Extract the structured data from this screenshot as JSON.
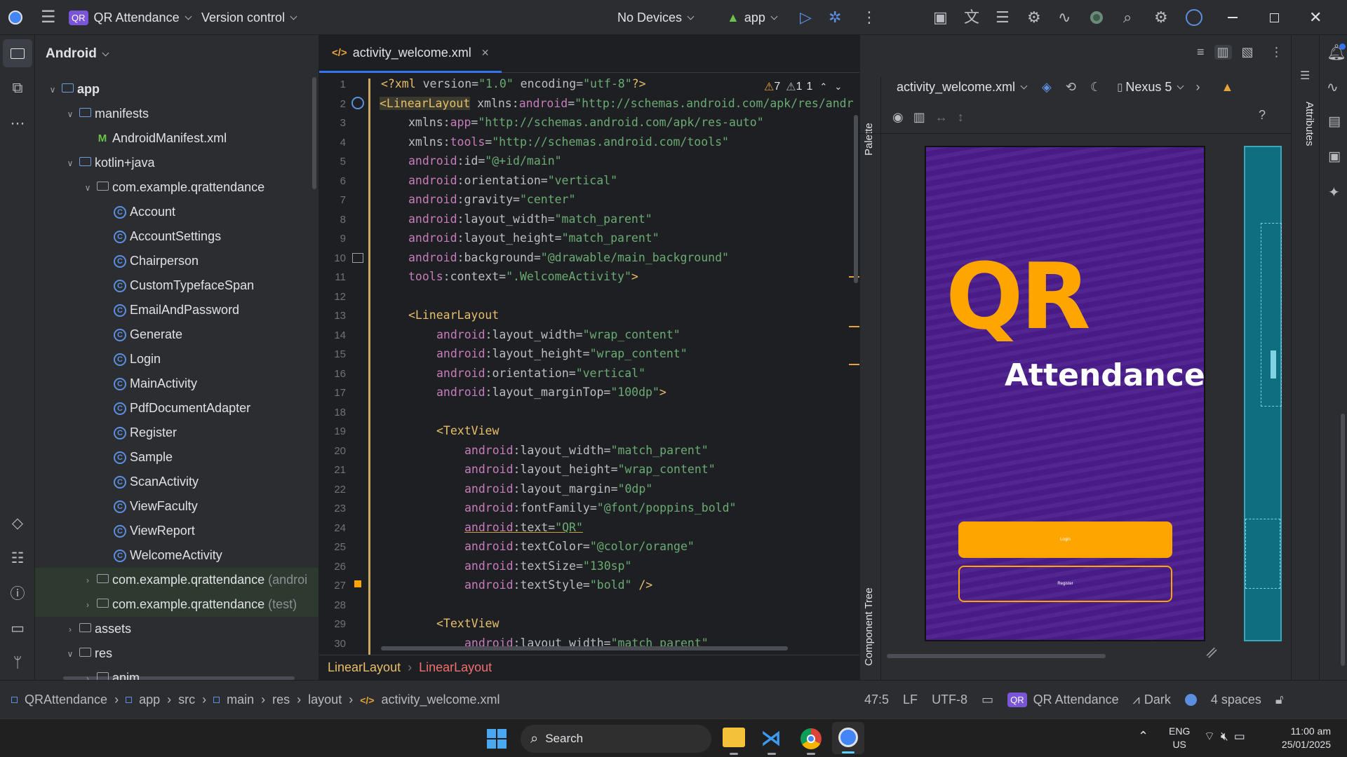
{
  "titlebar": {
    "project_badge": "QR",
    "project_name": "QR Attendance",
    "vcs": "Version control",
    "devices": "No Devices",
    "run_config": "app"
  },
  "project_panel": {
    "view_mode": "Android",
    "tree": [
      {
        "label": "app",
        "suffix": ""
      },
      {
        "label": "manifests",
        "suffix": ""
      },
      {
        "label": "AndroidManifest.xml",
        "suffix": ""
      },
      {
        "label": "kotlin+java",
        "suffix": ""
      },
      {
        "label": "com.example.qrattendance",
        "suffix": ""
      },
      {
        "label": "Account",
        "suffix": ""
      },
      {
        "label": "AccountSettings",
        "suffix": ""
      },
      {
        "label": "Chairperson",
        "suffix": ""
      },
      {
        "label": "CustomTypefaceSpan",
        "suffix": ""
      },
      {
        "label": "EmailAndPassword",
        "suffix": ""
      },
      {
        "label": "Generate",
        "suffix": ""
      },
      {
        "label": "Login",
        "suffix": ""
      },
      {
        "label": "MainActivity",
        "suffix": ""
      },
      {
        "label": "PdfDocumentAdapter",
        "suffix": ""
      },
      {
        "label": "Register",
        "suffix": ""
      },
      {
        "label": "Sample",
        "suffix": ""
      },
      {
        "label": "ScanActivity",
        "suffix": ""
      },
      {
        "label": "ViewFaculty",
        "suffix": ""
      },
      {
        "label": "ViewReport",
        "suffix": ""
      },
      {
        "label": "WelcomeActivity",
        "suffix": ""
      },
      {
        "label": "com.example.qrattendance",
        "suffix": "(androi"
      },
      {
        "label": "com.example.qrattendance",
        "suffix": "(test)"
      },
      {
        "label": "assets",
        "suffix": ""
      },
      {
        "label": "res",
        "suffix": ""
      },
      {
        "label": "anim",
        "suffix": ""
      }
    ]
  },
  "editor": {
    "tab_label": "activity_welcome.xml",
    "inspections": {
      "warnings": "7",
      "weak": "1",
      "typos": "1"
    },
    "line_numbers": [
      "1",
      "2",
      "3",
      "4",
      "5",
      "6",
      "7",
      "8",
      "9",
      "10",
      "11",
      "12",
      "13",
      "14",
      "15",
      "16",
      "17",
      "18",
      "19",
      "20",
      "21",
      "22",
      "23",
      "24",
      "25",
      "26",
      "27",
      "28",
      "29",
      "30"
    ],
    "breadcrumb": [
      "LinearLayout",
      "LinearLayout"
    ]
  },
  "design": {
    "file_select": "activity_welcome.xml",
    "device": "Nexus 5",
    "palette_label": "Palette",
    "component_tree_label": "Component Tree",
    "attributes_label": "Attributes",
    "preview": {
      "title_big": "QR",
      "title_sub": "Attendance",
      "login_label": "Login",
      "register_label": "Register"
    }
  },
  "statusbar": {
    "path": [
      "QRAttendance",
      "app",
      "src",
      "main",
      "res",
      "layout",
      "activity_welcome.xml"
    ],
    "position": "47:5",
    "line_sep": "LF",
    "encoding": "UTF-8",
    "project_badge": "QR",
    "project": "QR Attendance",
    "theme": "Dark",
    "indent": "4 spaces"
  },
  "taskbar": {
    "search_placeholder": "Search",
    "lang": "ENG",
    "region": "US",
    "time": "11:00 am",
    "date": "25/01/2025"
  },
  "colors": {
    "accent": "#3574f0",
    "phone_bg": "#4a1d8c",
    "orange": "#ffa500"
  }
}
